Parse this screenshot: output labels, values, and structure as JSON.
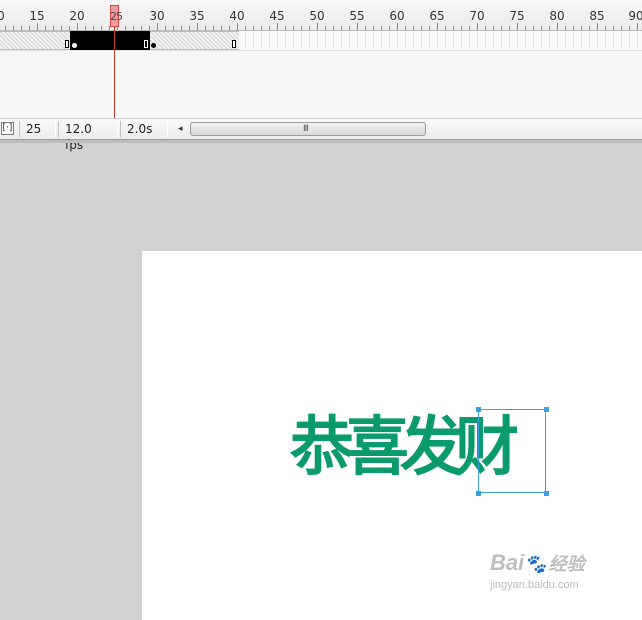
{
  "ruler": {
    "labels": [
      "0",
      "15",
      "20",
      "30",
      "35",
      "40",
      "45",
      "50",
      "55",
      "60",
      "65",
      "70",
      "75",
      "80",
      "85",
      "90"
    ]
  },
  "playhead": {
    "frame": "25"
  },
  "status": {
    "current_frame": "25",
    "frame_rate": "12.0 fps",
    "elapsed_time": "2.0s",
    "scroll_left_arrow": "◂",
    "scroll_grip": "III",
    "center_frame_glyph": "[·]"
  },
  "stage": {
    "artwork_text": "恭喜发财",
    "artwork_color": "#0a9a6b"
  },
  "watermark": {
    "logo_prefix": "Bai",
    "logo_cn": "经验",
    "url": "jingyan.baidu.com"
  }
}
